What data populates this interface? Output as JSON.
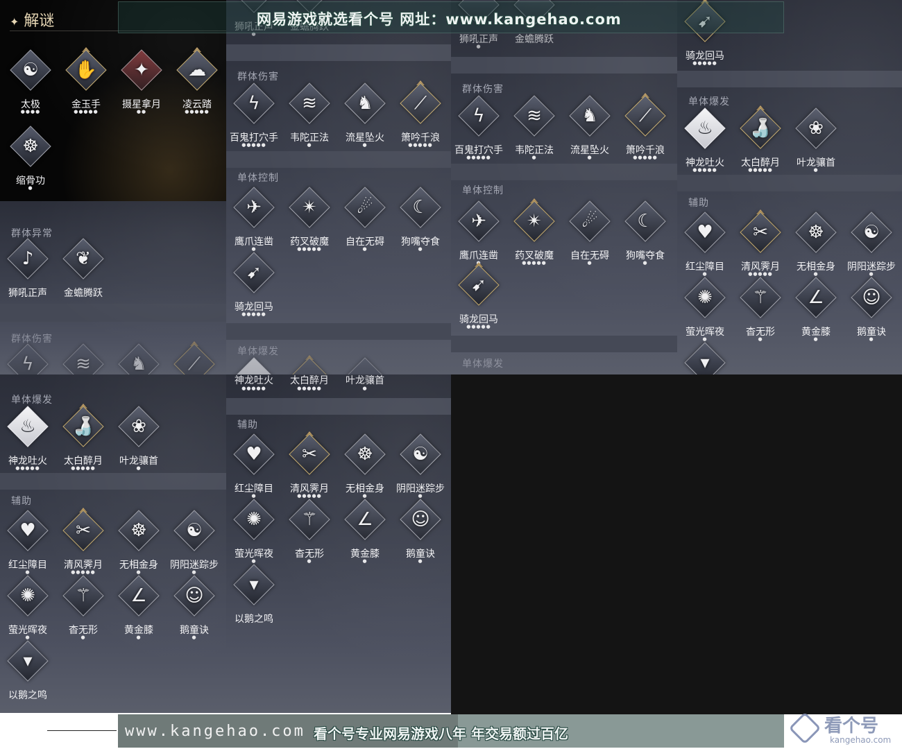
{
  "panel_title": "解谜",
  "puzzle": [
    {
      "name": "太极",
      "dots": "●●●●",
      "icon": "☯"
    },
    {
      "name": "金玉手",
      "dots": "●●●●●",
      "icon": "✋"
    },
    {
      "name": "摄星拿月",
      "dots": "●●",
      "icon": "✦"
    },
    {
      "name": "凌云踏",
      "dots": "●●●●●",
      "icon": "☁"
    },
    {
      "name": "缩骨功",
      "dots": "●",
      "icon": "☸"
    }
  ],
  "sections": {
    "aoe_status": "群体异常",
    "aoe_damage": "群体伤害",
    "single_control": "单体控制",
    "single_burst": "单体爆发",
    "support": "辅助"
  },
  "skills": {
    "shihou": {
      "name": "狮吼正声",
      "dots": "●",
      "icon": "♪"
    },
    "jinchan": {
      "name": "金蟾腾跃",
      "dots": "",
      "icon": "❦"
    },
    "baigui": {
      "name": "百鬼打穴手",
      "dots": "●●●●●",
      "icon": "ϟ"
    },
    "weituo": {
      "name": "韦陀正法",
      "dots": "●",
      "icon": "≋"
    },
    "liuxing": {
      "name": "流星坠火",
      "dots": "●",
      "icon": "♞"
    },
    "xiaoyin": {
      "name": "箫吟千浪",
      "dots": "●●●●●",
      "icon": "⟋"
    },
    "yingzhua": {
      "name": "鹰爪连凿",
      "dots": "●",
      "icon": "✈"
    },
    "yaocha": {
      "name": "药叉破魔",
      "dots": "●●●●●",
      "icon": "✴"
    },
    "zizai": {
      "name": "自在无碍",
      "dots": "●",
      "icon": "☄"
    },
    "goushi": {
      "name": "狗嘴夺食",
      "dots": "●",
      "icon": "☾"
    },
    "qilong": {
      "name": "骑龙回马",
      "dots": "●●●●●",
      "icon": "➹"
    },
    "shenlong": {
      "name": "神龙吐火",
      "dots": "●●●●●",
      "icon": "♨"
    },
    "taibai": {
      "name": "太白醉月",
      "dots": "●●●●●",
      "icon": "🍶"
    },
    "yelong": {
      "name": "叶龙骧首",
      "dots": "●",
      "icon": "❀"
    },
    "hongchen": {
      "name": "红尘障目",
      "dots": "●",
      "icon": "♥"
    },
    "qingfeng": {
      "name": "清风霁月",
      "dots": "●●●●●",
      "icon": "✂"
    },
    "wuxiang": {
      "name": "无相金身",
      "dots": "●",
      "icon": "☸"
    },
    "yinyang": {
      "name": "阴阳迷踪步",
      "dots": "●",
      "icon": "☯"
    },
    "yingguang": {
      "name": "萤光晖夜",
      "dots": "●",
      "icon": "✺"
    },
    "xingwu": {
      "name": "杳无形",
      "dots": "●",
      "icon": "⚚"
    },
    "huangjin": {
      "name": "黄金膝",
      "dots": "●",
      "icon": "∠"
    },
    "etong": {
      "name": "鹅童诀",
      "dots": "●",
      "icon": "☺"
    },
    "ezhiming": {
      "name": "以鹅之鸣",
      "dots": "",
      "icon": "▾"
    }
  },
  "watermark_top": "网易游戏就选看个号    网址：www.kangehao.com",
  "watermark_bottom_url": "www.kangehao.com",
  "watermark_bottom_slogan": "看个号专业网易游戏八年   年交易额过百亿",
  "logo_text": "看个号",
  "logo_domain": "kangehao.com",
  "colors": {
    "accent_gold": "#c9a66b",
    "panel_dark": "#060606",
    "tile_base": "#3b3f4c",
    "watermark_green": "#24463f"
  }
}
